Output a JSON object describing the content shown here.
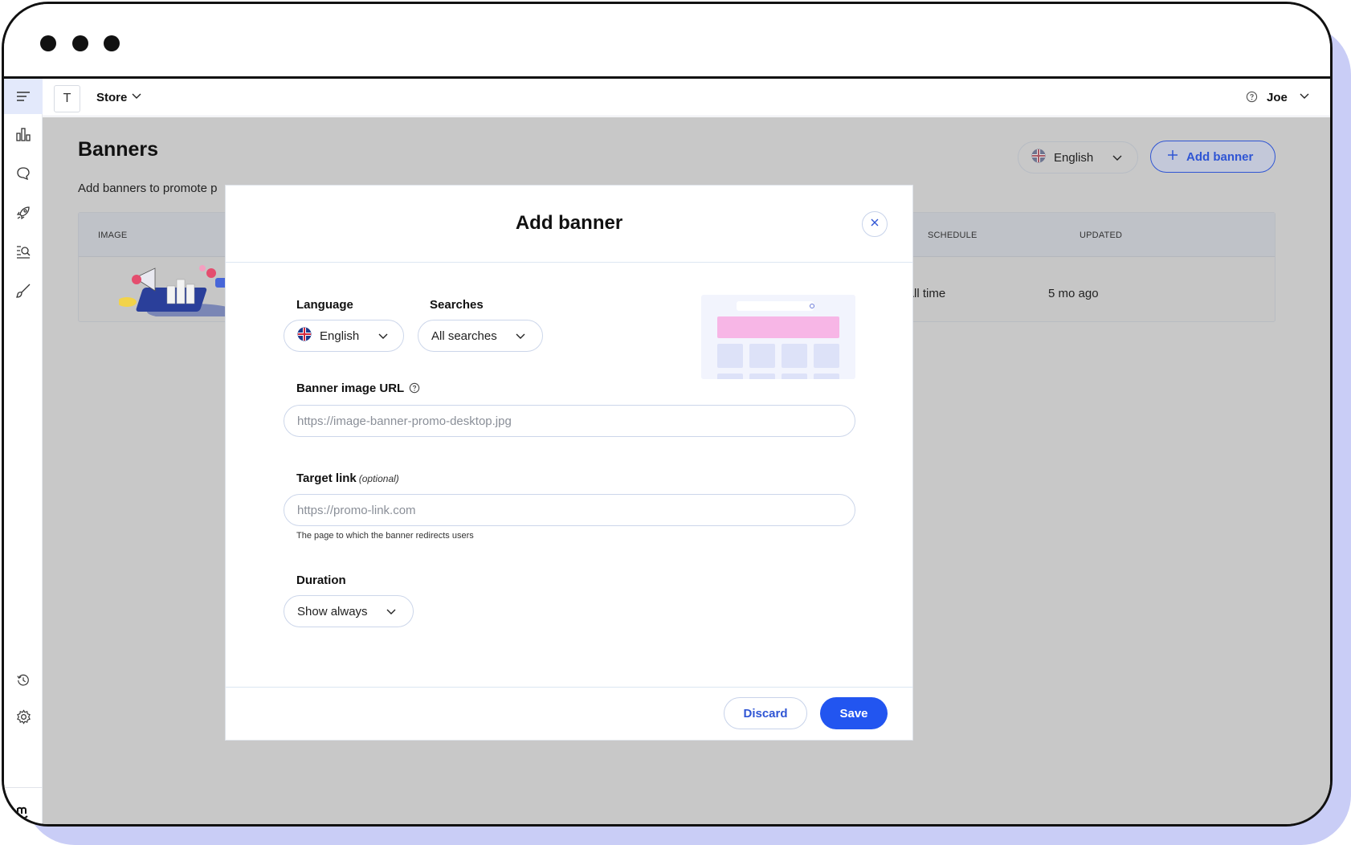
{
  "topbar": {
    "store_initial": "T",
    "store_name": "Store",
    "user_name": "Joe"
  },
  "page": {
    "title": "Banners",
    "subtitle": "Add banners to promote p",
    "language": "English",
    "add_button": "Add banner"
  },
  "table": {
    "headers": {
      "image": "IMAGE",
      "schedule": "SCHEDULE",
      "updated": "UPDATED"
    },
    "rows": [
      {
        "schedule": "All time",
        "updated": "5 mo ago"
      }
    ]
  },
  "modal": {
    "title": "Add banner",
    "language_label": "Language",
    "language_value": "English",
    "searches_label": "Searches",
    "searches_value": "All searches",
    "image_url_label": "Banner image URL",
    "image_url_placeholder": "https://image-banner-promo-desktop.jpg",
    "target_link_label": "Target link",
    "target_link_optional": "(optional)",
    "target_link_placeholder": "https://promo-link.com",
    "target_link_help": "The page to which the banner redirects users",
    "duration_label": "Duration",
    "duration_value": "Show always",
    "discard_label": "Discard",
    "save_label": "Save"
  },
  "colors": {
    "accent": "#2255f0",
    "overlay": "#c8c8c8",
    "frame_shadow": "#c9cdf6",
    "preview_banner": "#f7b6e6"
  },
  "icons": {
    "sidebar": [
      "menu-icon",
      "analytics-icon",
      "chat-icon",
      "rocket-icon",
      "search-list-icon",
      "brush-icon",
      "history-icon",
      "gear-icon",
      "logo-icon"
    ]
  }
}
